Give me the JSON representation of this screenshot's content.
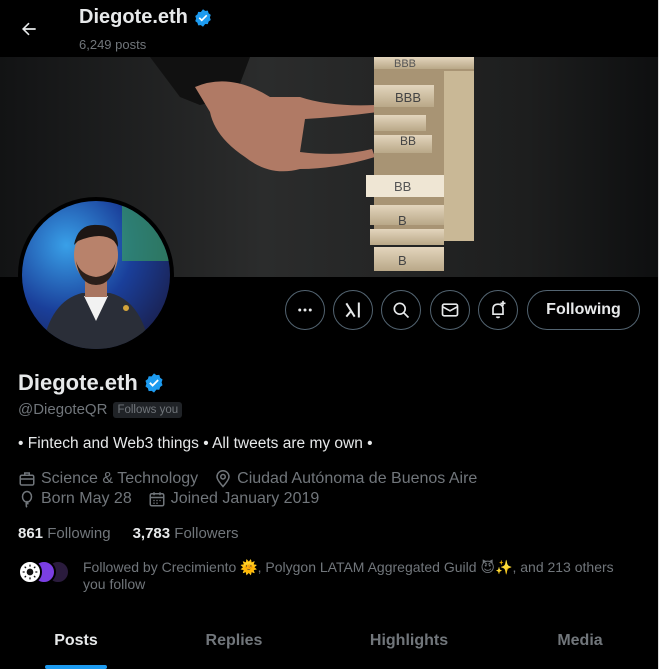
{
  "header": {
    "back_icon": "arrow-left-icon",
    "name": "Diegote.eth",
    "post_count": "6,249 posts",
    "verified_icon": "verified-badge-icon"
  },
  "banner": {
    "block_labels": [
      "BBB",
      "BBB",
      "BB",
      "BB",
      "B",
      "B"
    ]
  },
  "actions": {
    "more_icon": "more-icon",
    "grok_icon": "grok-icon",
    "search_icon": "search-icon",
    "message_icon": "mail-icon",
    "notify_icon": "bell-plus-icon",
    "follow_label": "Following"
  },
  "profile": {
    "name": "Diegote.eth",
    "handle": "@DiegoteQR",
    "follows_you": "Follows you",
    "bio": "• Fintech and Web3 things • All tweets are my own •",
    "category": "Science & Technology",
    "location": "Ciudad Autónoma de Buenos Aire",
    "birthday": "Born May 28",
    "joined": "Joined January 2019"
  },
  "stats": {
    "following_count": "861",
    "following_label": "Following",
    "followers_count": "3,783",
    "followers_label": "Followers"
  },
  "followed_by": {
    "line1": "Followed by Crecimiento 🌞, Polygon LATAM Aggregated Guild 😈✨, and 213 others",
    "line2": "you follow"
  },
  "tabs": [
    {
      "label": "Posts",
      "active": true
    },
    {
      "label": "Replies",
      "active": false
    },
    {
      "label": "Highlights",
      "active": false
    },
    {
      "label": "Media",
      "active": false
    }
  ],
  "colors": {
    "accent": "#1d9bf0",
    "muted": "#71767b",
    "text": "#e7e9ea",
    "background": "#000000"
  }
}
